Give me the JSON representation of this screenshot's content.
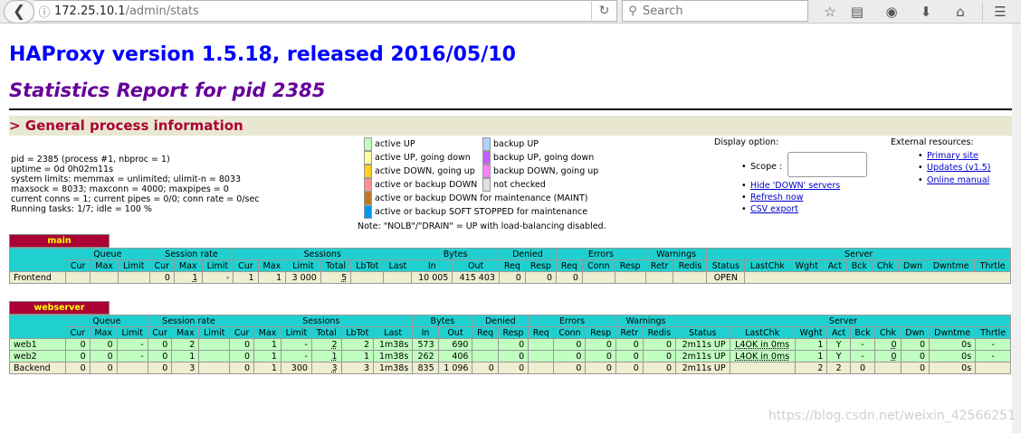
{
  "browser": {
    "url_host": "172.25.10.1",
    "url_path": "/admin/stats",
    "search_placeholder": "Search"
  },
  "page": {
    "title": "HAProxy version 1.5.18, released 2016/05/10",
    "subtitle": "Statistics Report for pid 2385",
    "section": "> General process information"
  },
  "process_info": [
    "pid = 2385 (process #1, nbproc = 1)",
    "uptime = 0d 0h02m11s",
    "system limits: memmax = unlimited; ulimit-n = 8033",
    "maxsock = 8033; maxconn = 4000; maxpipes = 0",
    "current conns = 1; current pipes = 0/0; conn rate = 0/sec",
    "Running tasks: 1/7; idle = 100 %"
  ],
  "legend": {
    "items": [
      {
        "label": "active UP",
        "color": "#c0ffc0"
      },
      {
        "label": "backup UP",
        "color": "#b0d0ff"
      },
      {
        "label": "active UP, going down",
        "color": "#ffffa0"
      },
      {
        "label": "backup UP, going down",
        "color": "#c060ff"
      },
      {
        "label": "active DOWN, going up",
        "color": "#ffd020"
      },
      {
        "label": "backup DOWN, going up",
        "color": "#ff80ff"
      },
      {
        "label": "active or backup DOWN",
        "color": "#ff9090"
      },
      {
        "label": "not checked",
        "color": "#e0e0e0"
      },
      {
        "label": "active or backup DOWN for maintenance (MAINT)",
        "color": "#c07820"
      },
      {
        "label": "active or backup SOFT STOPPED for maintenance",
        "color": "#0098f0"
      }
    ],
    "note": "Note: \"NOLB\"/\"DRAIN\" = UP with load-balancing disabled."
  },
  "display_options": {
    "title": "Display option:",
    "scope_label": "Scope :",
    "links": [
      "Hide 'DOWN' servers",
      "Refresh now",
      "CSV export"
    ]
  },
  "external_resources": {
    "title": "External resources:",
    "links": [
      "Primary site",
      "Updates (v1.5)",
      "Online manual"
    ]
  },
  "frontend": {
    "name": "main",
    "row": {
      "name": "Frontend",
      "queue_cur": "",
      "queue_max": "",
      "queue_limit": "",
      "sess_cur": "0",
      "sess_max": "1",
      "sess_limit": "-",
      "s_cur": "1",
      "s_max": "1",
      "s_limit": "3 000",
      "s_total": "5",
      "s_lbtot": "",
      "s_last": "",
      "b_in": "10 005",
      "b_out": "415 403",
      "d_req": "0",
      "d_resp": "0",
      "e_req": "0",
      "e_conn": "",
      "e_resp": "",
      "w_retr": "",
      "w_redis": "",
      "status": "OPEN",
      "lastchk": "",
      "wght": "",
      "act": "",
      "bck": "",
      "chk": "",
      "dwn": "",
      "dwntme": "",
      "thrtle": ""
    }
  },
  "backend": {
    "name": "webserver",
    "rows": [
      {
        "name": "web1",
        "q_cur": "0",
        "q_max": "0",
        "q_limit": "-",
        "sr_cur": "0",
        "sr_max": "2",
        "sr_limit": "",
        "s_cur": "0",
        "s_max": "1",
        "s_limit": "-",
        "s_total": "2",
        "s_lbtot": "2",
        "s_last": "1m38s",
        "b_in": "573",
        "b_out": "690",
        "d_req": "",
        "d_resp": "0",
        "e_req": "",
        "e_conn": "0",
        "e_resp": "0",
        "w_retr": "0",
        "w_redis": "0",
        "status": "2m11s UP",
        "lastchk": "L4OK in 0ms",
        "wght": "1",
        "act": "Y",
        "bck": "-",
        "chk": "0",
        "dwn": "0",
        "dwntme": "0s",
        "thrtle": "-"
      },
      {
        "name": "web2",
        "q_cur": "0",
        "q_max": "0",
        "q_limit": "-",
        "sr_cur": "0",
        "sr_max": "1",
        "sr_limit": "",
        "s_cur": "0",
        "s_max": "1",
        "s_limit": "-",
        "s_total": "1",
        "s_lbtot": "1",
        "s_last": "1m38s",
        "b_in": "262",
        "b_out": "406",
        "d_req": "",
        "d_resp": "0",
        "e_req": "",
        "e_conn": "0",
        "e_resp": "0",
        "w_retr": "0",
        "w_redis": "0",
        "status": "2m11s UP",
        "lastchk": "L4OK in 0ms",
        "wght": "1",
        "act": "Y",
        "bck": "-",
        "chk": "0",
        "dwn": "0",
        "dwntme": "0s",
        "thrtle": "-"
      },
      {
        "name": "Backend",
        "q_cur": "0",
        "q_max": "0",
        "q_limit": "",
        "sr_cur": "0",
        "sr_max": "3",
        "sr_limit": "",
        "s_cur": "0",
        "s_max": "1",
        "s_limit": "300",
        "s_total": "3",
        "s_lbtot": "3",
        "s_last": "1m38s",
        "b_in": "835",
        "b_out": "1 096",
        "d_req": "0",
        "d_resp": "0",
        "e_req": "",
        "e_conn": "0",
        "e_resp": "0",
        "w_retr": "0",
        "w_redis": "0",
        "status": "2m11s UP",
        "lastchk": "",
        "wght": "2",
        "act": "2",
        "bck": "0",
        "chk": "",
        "dwn": "0",
        "dwntme": "0s",
        "thrtle": ""
      }
    ]
  },
  "headers": {
    "groups": [
      "Queue",
      "Session rate",
      "Sessions",
      "Bytes",
      "Denied",
      "Errors",
      "Warnings",
      "Server"
    ],
    "cols": [
      "Cur",
      "Max",
      "Limit",
      "Cur",
      "Max",
      "Limit",
      "Cur",
      "Max",
      "Limit",
      "Total",
      "LbTot",
      "Last",
      "In",
      "Out",
      "Req",
      "Resp",
      "Req",
      "Conn",
      "Resp",
      "Retr",
      "Redis",
      "Status",
      "LastChk",
      "Wght",
      "Act",
      "Bck",
      "Chk",
      "Dwn",
      "Dwntme",
      "Thrtle"
    ]
  },
  "watermark": "https://blog.csdn.net/weixin_42566251"
}
